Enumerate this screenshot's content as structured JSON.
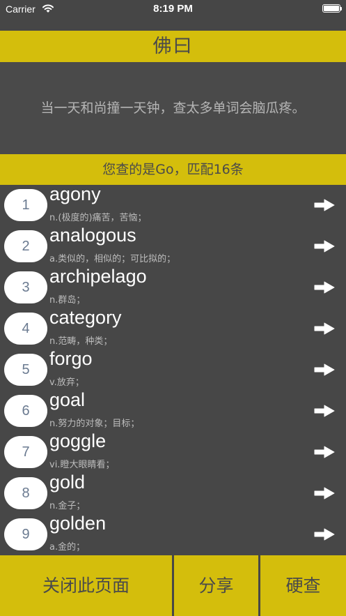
{
  "status_bar": {
    "carrier": "Carrier",
    "time": "8:19 PM"
  },
  "title": "佛曰",
  "quote": "当一天和尚撞一天钟，查太多单词会脑瓜疼。",
  "match_text": "您查的是Go，匹配16条",
  "words": [
    {
      "num": "1",
      "word": "agony",
      "def": "n.(极度的)痛苦，苦恼；"
    },
    {
      "num": "2",
      "word": "analogous",
      "def": "a.类似的，相似的；可比拟的；"
    },
    {
      "num": "3",
      "word": "archipelago",
      "def": "n.群岛；"
    },
    {
      "num": "4",
      "word": "category",
      "def": "n.范畴，种类；"
    },
    {
      "num": "5",
      "word": "forgo",
      "def": "v.放弃；"
    },
    {
      "num": "6",
      "word": "goal",
      "def": "n.努力的对象；目标；"
    },
    {
      "num": "7",
      "word": "goggle",
      "def": "vi.瞪大眼睛看；"
    },
    {
      "num": "8",
      "word": "gold",
      "def": "n.金子；"
    },
    {
      "num": "9",
      "word": "golden",
      "def": "a.金的；"
    }
  ],
  "buttons": {
    "close": "关闭此页面",
    "share": "分享",
    "hard_lookup": "硬查"
  },
  "colors": {
    "accent_yellow": "#d4be0c",
    "background_dark": "#4a4a4a"
  },
  "icons": {
    "wifi": "wifi-icon",
    "battery": "battery-icon",
    "row_arrow": "arrow-right-icon"
  }
}
